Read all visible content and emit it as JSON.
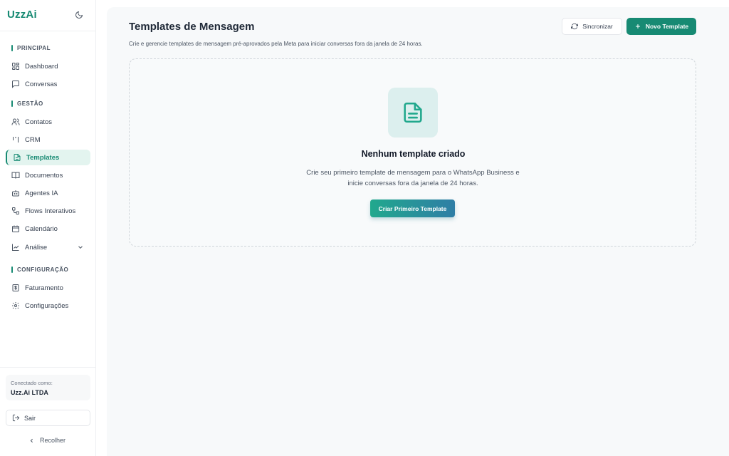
{
  "app": {
    "name": "UzzAi"
  },
  "colors": {
    "accent": "#178a73",
    "active_bg": "#e3f4ef",
    "main_bg": "#f7f9fa"
  },
  "sidebar": {
    "sections": [
      {
        "label": "PRINCIPAL"
      },
      {
        "label": "GESTÃO"
      },
      {
        "label": "CONFIGURAÇÃO"
      }
    ],
    "items": [
      {
        "label": "Dashboard",
        "icon": "dashboard-icon"
      },
      {
        "label": "Conversas",
        "icon": "chat-icon"
      },
      {
        "label": "Contatos",
        "icon": "users-icon"
      },
      {
        "label": "CRM",
        "icon": "kanban-icon"
      },
      {
        "label": "Templates",
        "icon": "file-text-icon",
        "active": true
      },
      {
        "label": "Documentos",
        "icon": "book-icon"
      },
      {
        "label": "Agentes IA",
        "icon": "bot-icon"
      },
      {
        "label": "Flows Interativos",
        "icon": "flow-icon"
      },
      {
        "label": "Calendário",
        "icon": "calendar-icon"
      },
      {
        "label": "Análise",
        "icon": "chart-line-icon",
        "expandable": true
      },
      {
        "label": "Faturamento",
        "icon": "receipt-icon"
      },
      {
        "label": "Configurações",
        "icon": "gear-icon"
      }
    ],
    "connected_label": "Conectado como:",
    "connected_name": "Uzz.Ai LTDA",
    "logout_label": "Sair",
    "collapse_label": "Recolher"
  },
  "header": {
    "title": "Templates de Mensagem",
    "subtitle": "Crie e gerencie templates de mensagem pré-aprovados pela Meta para iniciar conversas fora da janela de 24 horas.",
    "sync_label": "Sincronizar",
    "new_label": "Novo Template"
  },
  "empty_state": {
    "title": "Nenhum template criado",
    "description": "Crie seu primeiro template de mensagem para o WhatsApp Business e inicie conversas fora da janela de 24 horas.",
    "cta_label": "Criar Primeiro Template"
  }
}
